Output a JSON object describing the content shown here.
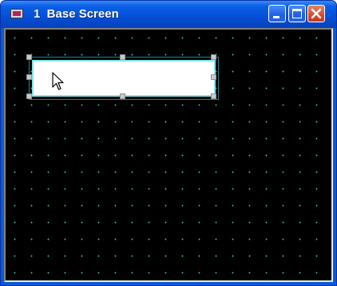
{
  "window": {
    "title": "1  Base Screen",
    "controls": {
      "minimize": "minimize-icon",
      "maximize": "maximize-icon",
      "close": "close-icon"
    }
  },
  "canvas": {
    "background": "#000000",
    "grid_color": "#2fb8a8",
    "selected_object": {
      "type": "text-box",
      "fill": "#ffffff",
      "border": "#7fe6f0"
    }
  },
  "colors": {
    "titlebar": "#0553dc",
    "close_button": "#d7492a"
  }
}
